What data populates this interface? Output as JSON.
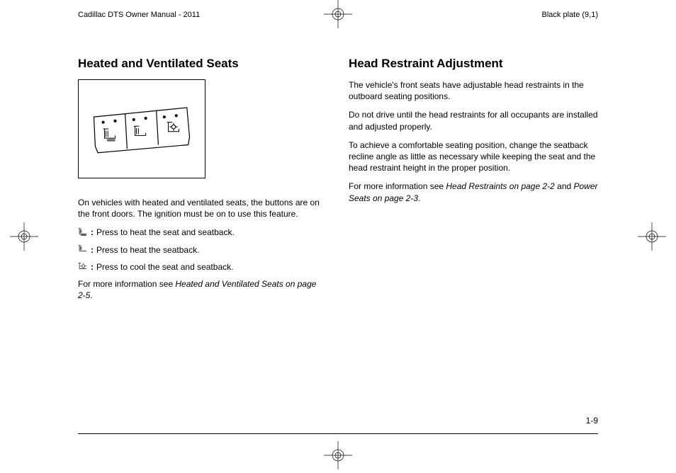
{
  "header": {
    "left": "Cadillac DTS Owner Manual - 2011",
    "right": "Black plate (9,1)"
  },
  "left_col": {
    "heading": "Heated and Ventilated Seats",
    "intro": "On vehicles with heated and ventilated seats, the buttons are on the front doors. The ignition must be on to use this feature.",
    "bullet1": "Press to heat the seat and seatback.",
    "bullet2": "Press to heat the seatback.",
    "bullet3": "Press to cool the seat and seatback.",
    "ref_prefix": "For more information see ",
    "ref_italic": "Heated and Ventilated Seats on page 2‑5",
    "ref_suffix": "."
  },
  "right_col": {
    "heading": "Head Restraint Adjustment",
    "p1": "The vehicle's front seats have adjustable head restraints in the outboard seating positions.",
    "p2": "Do not drive until the head restraints for all occupants are installed and adjusted properly.",
    "p3": "To achieve a comfortable seating position, change the seatback recline angle as little as necessary while keeping the seat and the head restraint height in the proper position.",
    "ref_prefix": "For more information see ",
    "ref_italic1": "Head Restraints on page 2‑2",
    "ref_mid": " and ",
    "ref_italic2": "Power Seats on page 2‑3",
    "ref_suffix": "."
  },
  "footer": {
    "page_num": "1-9"
  },
  "labels": {
    "colon": " : "
  }
}
